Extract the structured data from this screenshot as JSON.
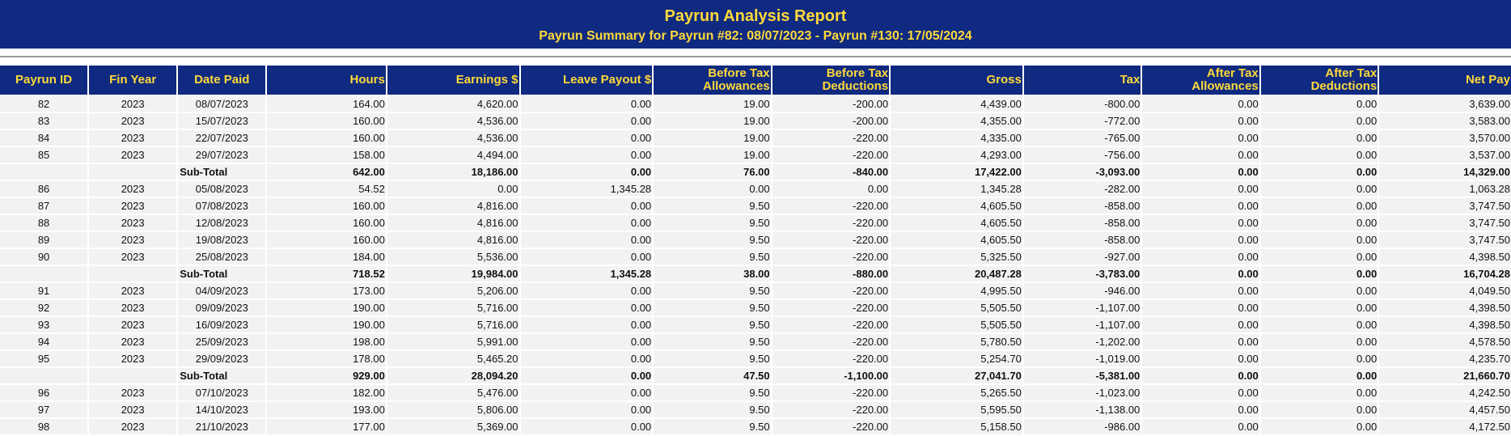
{
  "report": {
    "title": "Payrun Analysis Report",
    "subtitle": "Payrun Summary for Payrun #82: 08/07/2023 - Payrun #130: 17/05/2024"
  },
  "colors": {
    "header_bg": "#0f2a80",
    "header_text": "#ffd93b",
    "row_bg": "#f2f2f2"
  },
  "columns": [
    {
      "key": "id",
      "label": "Payrun ID",
      "align": "c"
    },
    {
      "key": "year",
      "label": "Fin Year",
      "align": "c"
    },
    {
      "key": "date",
      "label": "Date Paid",
      "align": "c"
    },
    {
      "key": "hours",
      "label": "Hours",
      "align": "r"
    },
    {
      "key": "earnings",
      "label": "Earnings $",
      "align": "r"
    },
    {
      "key": "leave",
      "label": "Leave Payout $",
      "align": "r"
    },
    {
      "key": "bta",
      "label": "Before Tax Allowances",
      "align": "r"
    },
    {
      "key": "btd",
      "label": "Before Tax Deductions",
      "align": "r"
    },
    {
      "key": "gross",
      "label": "Gross",
      "align": "r"
    },
    {
      "key": "tax",
      "label": "Tax",
      "align": "r"
    },
    {
      "key": "ata",
      "label": "After Tax Allowances",
      "align": "r"
    },
    {
      "key": "atd",
      "label": "After Tax Deductions",
      "align": "r"
    },
    {
      "key": "net",
      "label": "Net Pay",
      "align": "r"
    }
  ],
  "rows": [
    {
      "type": "row",
      "cells": [
        "82",
        "2023",
        "08/07/2023",
        "164.00",
        "4,620.00",
        "0.00",
        "19.00",
        "-200.00",
        "4,439.00",
        "-800.00",
        "0.00",
        "0.00",
        "3,639.00"
      ]
    },
    {
      "type": "row",
      "cells": [
        "83",
        "2023",
        "15/07/2023",
        "160.00",
        "4,536.00",
        "0.00",
        "19.00",
        "-200.00",
        "4,355.00",
        "-772.00",
        "0.00",
        "0.00",
        "3,583.00"
      ]
    },
    {
      "type": "row",
      "cells": [
        "84",
        "2023",
        "22/07/2023",
        "160.00",
        "4,536.00",
        "0.00",
        "19.00",
        "-220.00",
        "4,335.00",
        "-765.00",
        "0.00",
        "0.00",
        "3,570.00"
      ]
    },
    {
      "type": "row",
      "cells": [
        "85",
        "2023",
        "29/07/2023",
        "158.00",
        "4,494.00",
        "0.00",
        "19.00",
        "-220.00",
        "4,293.00",
        "-756.00",
        "0.00",
        "0.00",
        "3,537.00"
      ]
    },
    {
      "type": "subtotal",
      "cells": [
        "",
        "",
        "Sub-Total",
        "642.00",
        "18,186.00",
        "0.00",
        "76.00",
        "-840.00",
        "17,422.00",
        "-3,093.00",
        "0.00",
        "0.00",
        "14,329.00"
      ]
    },
    {
      "type": "row",
      "cells": [
        "86",
        "2023",
        "05/08/2023",
        "54.52",
        "0.00",
        "1,345.28",
        "0.00",
        "0.00",
        "1,345.28",
        "-282.00",
        "0.00",
        "0.00",
        "1,063.28"
      ]
    },
    {
      "type": "row",
      "cells": [
        "87",
        "2023",
        "07/08/2023",
        "160.00",
        "4,816.00",
        "0.00",
        "9.50",
        "-220.00",
        "4,605.50",
        "-858.00",
        "0.00",
        "0.00",
        "3,747.50"
      ]
    },
    {
      "type": "row",
      "cells": [
        "88",
        "2023",
        "12/08/2023",
        "160.00",
        "4,816.00",
        "0.00",
        "9.50",
        "-220.00",
        "4,605.50",
        "-858.00",
        "0.00",
        "0.00",
        "3,747.50"
      ]
    },
    {
      "type": "row",
      "cells": [
        "89",
        "2023",
        "19/08/2023",
        "160.00",
        "4,816.00",
        "0.00",
        "9.50",
        "-220.00",
        "4,605.50",
        "-858.00",
        "0.00",
        "0.00",
        "3,747.50"
      ]
    },
    {
      "type": "row",
      "cells": [
        "90",
        "2023",
        "25/08/2023",
        "184.00",
        "5,536.00",
        "0.00",
        "9.50",
        "-220.00",
        "5,325.50",
        "-927.00",
        "0.00",
        "0.00",
        "4,398.50"
      ]
    },
    {
      "type": "subtotal",
      "cells": [
        "",
        "",
        "Sub-Total",
        "718.52",
        "19,984.00",
        "1,345.28",
        "38.00",
        "-880.00",
        "20,487.28",
        "-3,783.00",
        "0.00",
        "0.00",
        "16,704.28"
      ]
    },
    {
      "type": "row",
      "cells": [
        "91",
        "2023",
        "04/09/2023",
        "173.00",
        "5,206.00",
        "0.00",
        "9.50",
        "-220.00",
        "4,995.50",
        "-946.00",
        "0.00",
        "0.00",
        "4,049.50"
      ]
    },
    {
      "type": "row",
      "cells": [
        "92",
        "2023",
        "09/09/2023",
        "190.00",
        "5,716.00",
        "0.00",
        "9.50",
        "-220.00",
        "5,505.50",
        "-1,107.00",
        "0.00",
        "0.00",
        "4,398.50"
      ]
    },
    {
      "type": "row",
      "cells": [
        "93",
        "2023",
        "16/09/2023",
        "190.00",
        "5,716.00",
        "0.00",
        "9.50",
        "-220.00",
        "5,505.50",
        "-1,107.00",
        "0.00",
        "0.00",
        "4,398.50"
      ]
    },
    {
      "type": "row",
      "cells": [
        "94",
        "2023",
        "25/09/2023",
        "198.00",
        "5,991.00",
        "0.00",
        "9.50",
        "-220.00",
        "5,780.50",
        "-1,202.00",
        "0.00",
        "0.00",
        "4,578.50"
      ]
    },
    {
      "type": "row",
      "cells": [
        "95",
        "2023",
        "29/09/2023",
        "178.00",
        "5,465.20",
        "0.00",
        "9.50",
        "-220.00",
        "5,254.70",
        "-1,019.00",
        "0.00",
        "0.00",
        "4,235.70"
      ]
    },
    {
      "type": "subtotal",
      "cells": [
        "",
        "",
        "Sub-Total",
        "929.00",
        "28,094.20",
        "0.00",
        "47.50",
        "-1,100.00",
        "27,041.70",
        "-5,381.00",
        "0.00",
        "0.00",
        "21,660.70"
      ]
    },
    {
      "type": "row",
      "cells": [
        "96",
        "2023",
        "07/10/2023",
        "182.00",
        "5,476.00",
        "0.00",
        "9.50",
        "-220.00",
        "5,265.50",
        "-1,023.00",
        "0.00",
        "0.00",
        "4,242.50"
      ]
    },
    {
      "type": "row",
      "cells": [
        "97",
        "2023",
        "14/10/2023",
        "193.00",
        "5,806.00",
        "0.00",
        "9.50",
        "-220.00",
        "5,595.50",
        "-1,138.00",
        "0.00",
        "0.00",
        "4,457.50"
      ]
    },
    {
      "type": "row",
      "cells": [
        "98",
        "2023",
        "21/10/2023",
        "177.00",
        "5,369.00",
        "0.00",
        "9.50",
        "-220.00",
        "5,158.50",
        "-986.00",
        "0.00",
        "0.00",
        "4,172.50"
      ]
    }
  ]
}
